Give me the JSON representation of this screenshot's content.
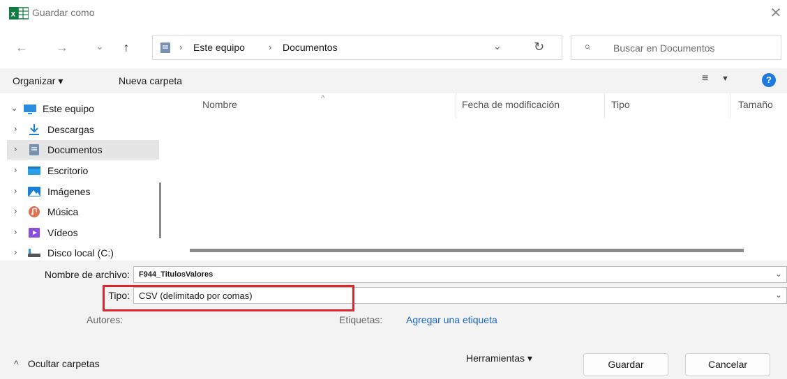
{
  "window": {
    "title": "Guardar como",
    "close_glyph": "✕"
  },
  "nav": {
    "back_glyph": "←",
    "forward_glyph": "→",
    "recent_glyph": "⌄",
    "up_glyph": "↑",
    "breadcrumb": [
      "Este equipo",
      "Documentos"
    ],
    "breadcrumb_sep": "›",
    "dropdown_glyph": "⌄",
    "refresh_glyph": "↻",
    "search_placeholder": "Buscar en Documentos"
  },
  "toolbar": {
    "organize_label": "Organizar ▾",
    "new_folder_label": "Nueva carpeta",
    "view_glyph": "≡",
    "view_dd_glyph": "▼",
    "help_glyph": "?"
  },
  "sidebar": {
    "items": [
      {
        "label": "Este equipo",
        "chevron": "⌄",
        "icon": "monitor-icon",
        "color": "#2a8de0"
      },
      {
        "label": "Descargas",
        "chevron": "›",
        "icon": "download-icon",
        "color": "#1e7fd8"
      },
      {
        "label": "Documentos",
        "chevron": "›",
        "icon": "documents-icon",
        "color": "#7a90b0",
        "selected": true
      },
      {
        "label": "Escritorio",
        "chevron": "›",
        "icon": "desktop-icon",
        "color": "#2aa0e8"
      },
      {
        "label": "Imágenes",
        "chevron": "›",
        "icon": "pictures-icon",
        "color": "#1b7fd6"
      },
      {
        "label": "Música",
        "chevron": "›",
        "icon": "music-icon",
        "color": "#e0704f"
      },
      {
        "label": "Vídeos",
        "chevron": "›",
        "icon": "videos-icon",
        "color": "#8a4ee0"
      },
      {
        "label": "Disco local (C:)",
        "chevron": "›",
        "icon": "drive-icon",
        "color": "#555555"
      }
    ]
  },
  "files": {
    "columns": [
      "Nombre",
      "Fecha de modificación",
      "Tipo",
      "Tamaño"
    ],
    "sort_glyph": "^"
  },
  "form": {
    "filename_label": "Nombre de archivo:",
    "filename_value": "F944_TitulosValores",
    "type_label": "Tipo:",
    "type_value": "CSV (delimitado por comas)",
    "authors_label": "Autores:",
    "tags_label": "Etiquetas:",
    "tags_link": "Agregar una etiqueta",
    "arrow_glyph": "⌄",
    "highlight_color": "#e0242a"
  },
  "footer": {
    "hide_folders_label": "Ocultar carpetas",
    "hide_folders_glyph": "^",
    "tools_label": "Herramientas ▾",
    "save_label": "Guardar",
    "cancel_label": "Cancelar"
  }
}
